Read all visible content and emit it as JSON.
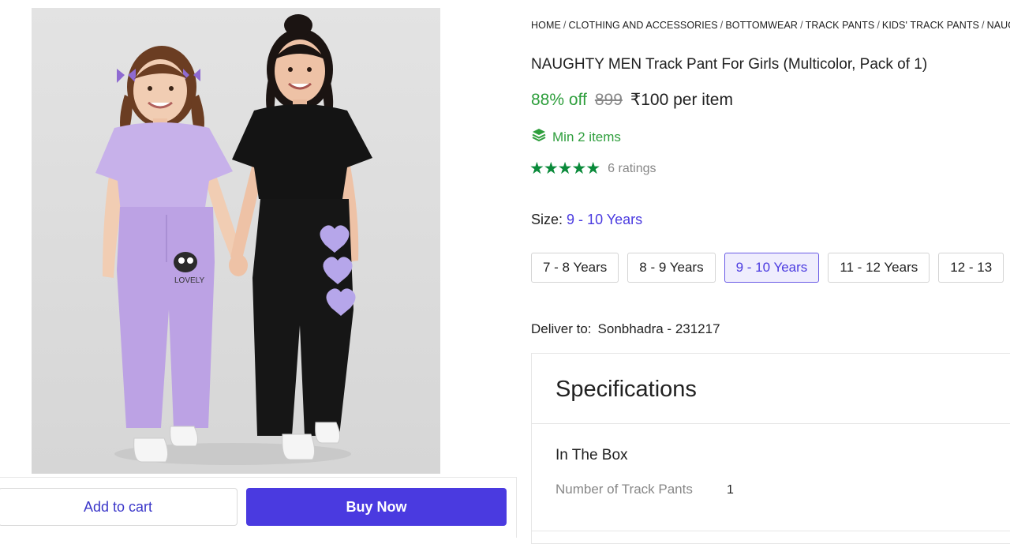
{
  "breadcrumb": [
    "HOME",
    "CLOTHING AND ACCESSORIES",
    "BOTTOMWEAR",
    "TRACK PANTS",
    "KIDS' TRACK PANTS",
    "NAUGH"
  ],
  "product": {
    "title": "NAUGHTY MEN Track Pant For Girls (Multicolor, Pack of 1)",
    "discount": "88% off",
    "mrp": "899",
    "price": "₹100 per item",
    "min_items": "Min 2 items",
    "stars_display": "★★★★★",
    "ratings": "6 ratings",
    "image_print_text": "LOVELY"
  },
  "size": {
    "label": "Size:",
    "selected": "9 - 10 Years",
    "options": [
      "7 - 8 Years",
      "8 - 9 Years",
      "9 - 10 Years",
      "11 - 12 Years",
      "12 - 13"
    ]
  },
  "delivery": {
    "label": "Deliver to:",
    "location": "Sonbhadra - 231217"
  },
  "specifications": {
    "title": "Specifications",
    "group": "In The Box",
    "key": "Number of Track Pants",
    "value": "1"
  },
  "actions": {
    "add_to_cart": "Add to cart",
    "buy_now": "Buy Now"
  },
  "colors": {
    "accent": "#4a3ae0",
    "green": "#2e9e3c",
    "star_green": "#0a8a3a"
  },
  "icons": {
    "min_items": "layers-icon",
    "stars": "star-icon"
  }
}
